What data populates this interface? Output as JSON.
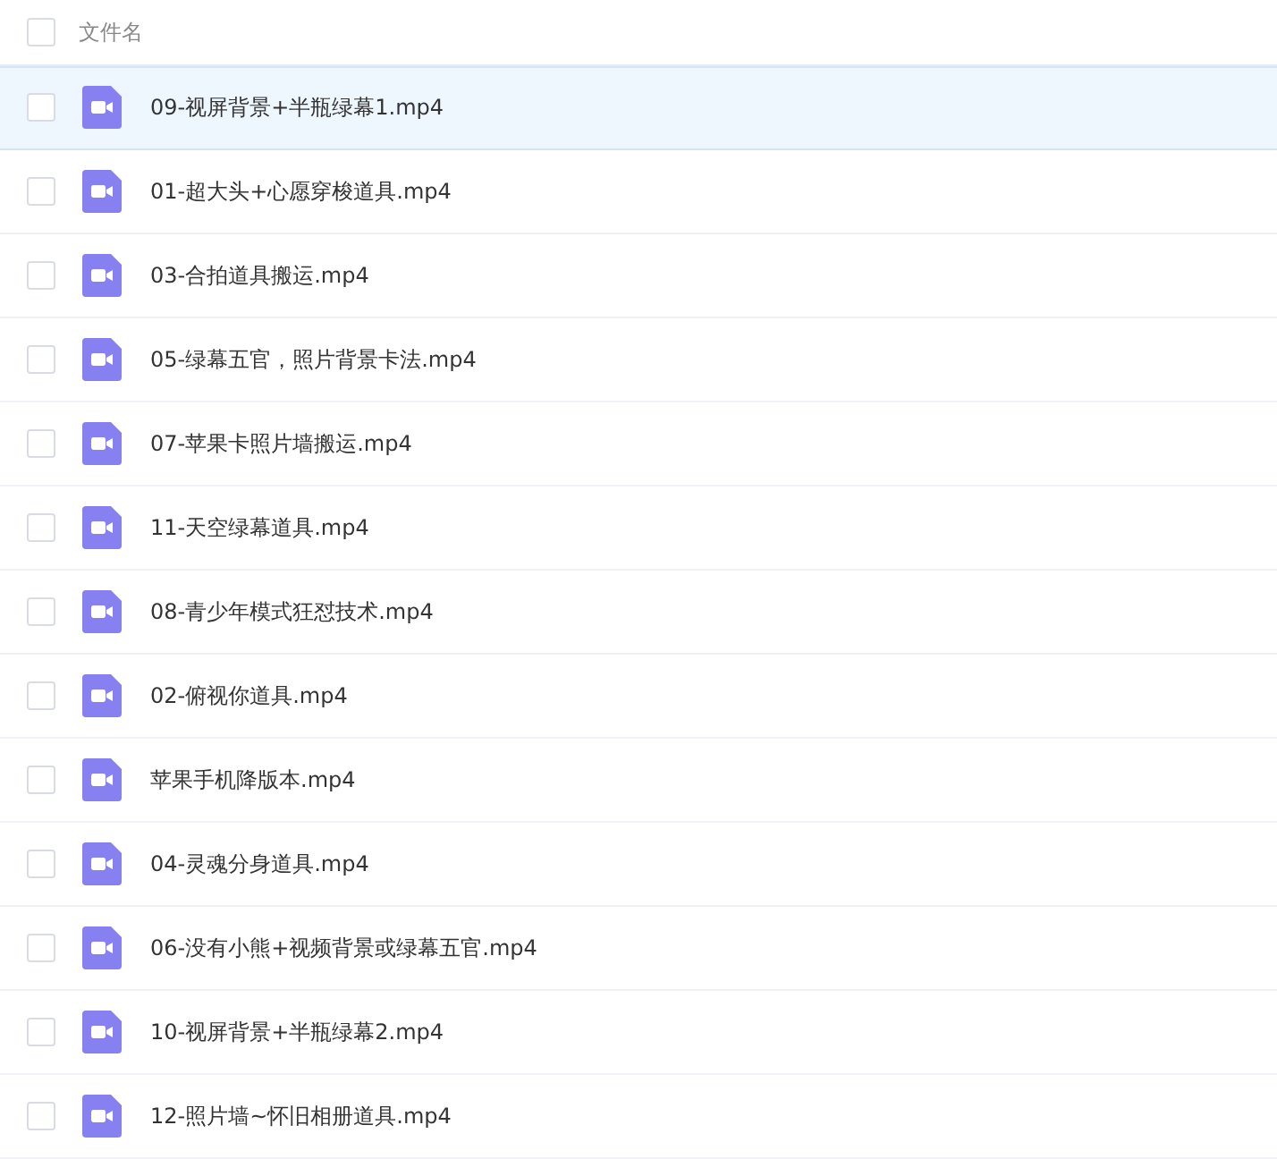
{
  "header": {
    "label": "文件名",
    "checked": false
  },
  "files": [
    {
      "name": "09-视屏背景+半瓶绿幕1.mp4",
      "selected": true,
      "checked": false
    },
    {
      "name": "01-超大头+心愿穿梭道具.mp4",
      "selected": false,
      "checked": false
    },
    {
      "name": "03-合拍道具搬运.mp4",
      "selected": false,
      "checked": false
    },
    {
      "name": "05-绿幕五官，照片背景卡法.mp4",
      "selected": false,
      "checked": false
    },
    {
      "name": "07-苹果卡照片墙搬运.mp4",
      "selected": false,
      "checked": false
    },
    {
      "name": "11-天空绿幕道具.mp4",
      "selected": false,
      "checked": false
    },
    {
      "name": "08-青少年模式狂怼技术.mp4",
      "selected": false,
      "checked": false
    },
    {
      "name": "02-俯视你道具.mp4",
      "selected": false,
      "checked": false
    },
    {
      "name": "苹果手机降版本.mp4",
      "selected": false,
      "checked": false
    },
    {
      "name": "04-灵魂分身道具.mp4",
      "selected": false,
      "checked": false
    },
    {
      "name": "06-没有小熊+视频背景或绿幕五官.mp4",
      "selected": false,
      "checked": false
    },
    {
      "name": "10-视屏背景+半瓶绿幕2.mp4",
      "selected": false,
      "checked": false
    },
    {
      "name": "12-照片墙~怀旧相册道具.mp4",
      "selected": false,
      "checked": false
    }
  ]
}
